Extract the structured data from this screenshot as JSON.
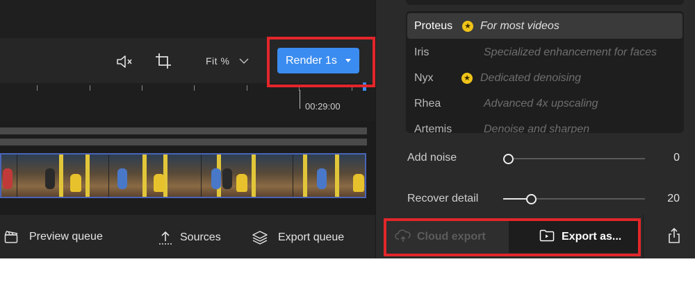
{
  "toolbar": {
    "fit_label": "Fit %",
    "render_label": "Render 1s"
  },
  "timeline": {
    "timecode": "00:29:00"
  },
  "bottom_bar": {
    "preview_queue": "Preview queue",
    "sources": "Sources",
    "export_queue": "Export queue"
  },
  "models": [
    {
      "name": "Proteus",
      "star": true,
      "description": "For most videos",
      "selected": true
    },
    {
      "name": "Iris",
      "star": false,
      "description": "Specialized enhancement for faces",
      "selected": false
    },
    {
      "name": "Nyx",
      "star": true,
      "description": "Dedicated denoising",
      "selected": false
    },
    {
      "name": "Rhea",
      "star": false,
      "description": "Advanced 4x upscaling",
      "selected": false
    },
    {
      "name": "Artemis",
      "star": false,
      "description": "Denoise and sharpen",
      "selected": false
    }
  ],
  "sliders": {
    "add_noise": {
      "label": "Add noise",
      "value": "0",
      "fraction": 0.0
    },
    "recover_detail": {
      "label": "Recover detail",
      "value": "20",
      "fraction": 0.2
    }
  },
  "export": {
    "cloud_label": "Cloud export",
    "export_as_label": "Export as..."
  },
  "colors": {
    "accent": "#3b8cf0",
    "highlight": "#e2262a",
    "star": "#f0c419"
  }
}
